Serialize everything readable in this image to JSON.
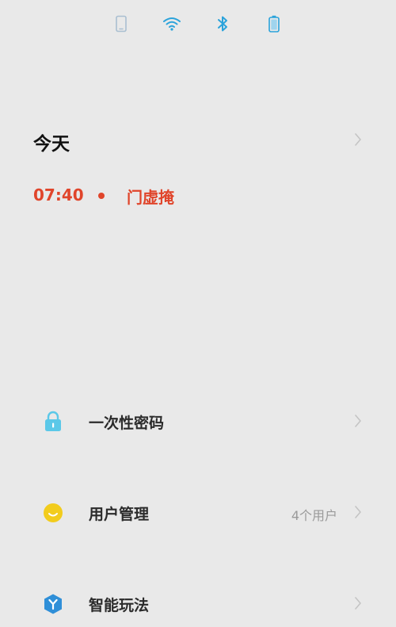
{
  "status_bar": {
    "icons": [
      "phone-icon",
      "wifi-icon",
      "bluetooth-icon",
      "battery-icon"
    ],
    "colors": {
      "phone": "#a9bfd1",
      "active": "#2ba3db"
    }
  },
  "today": {
    "title": "今天"
  },
  "event": {
    "time": "07:40",
    "label": "门虚掩",
    "color": "#e0452b"
  },
  "menu": {
    "items": [
      {
        "label": "一次性密码",
        "detail": "",
        "icon": "lock-icon",
        "icon_color": "#5bc8e8"
      },
      {
        "label": "用户管理",
        "detail": "4个用户",
        "icon": "smile-icon",
        "icon_color": "#f2cc1d"
      },
      {
        "label": "智能玩法",
        "detail": "",
        "icon": "hexagon-y-icon",
        "icon_color": "#2f8fd8"
      }
    ]
  },
  "chevron_color": "#c4c4c4"
}
